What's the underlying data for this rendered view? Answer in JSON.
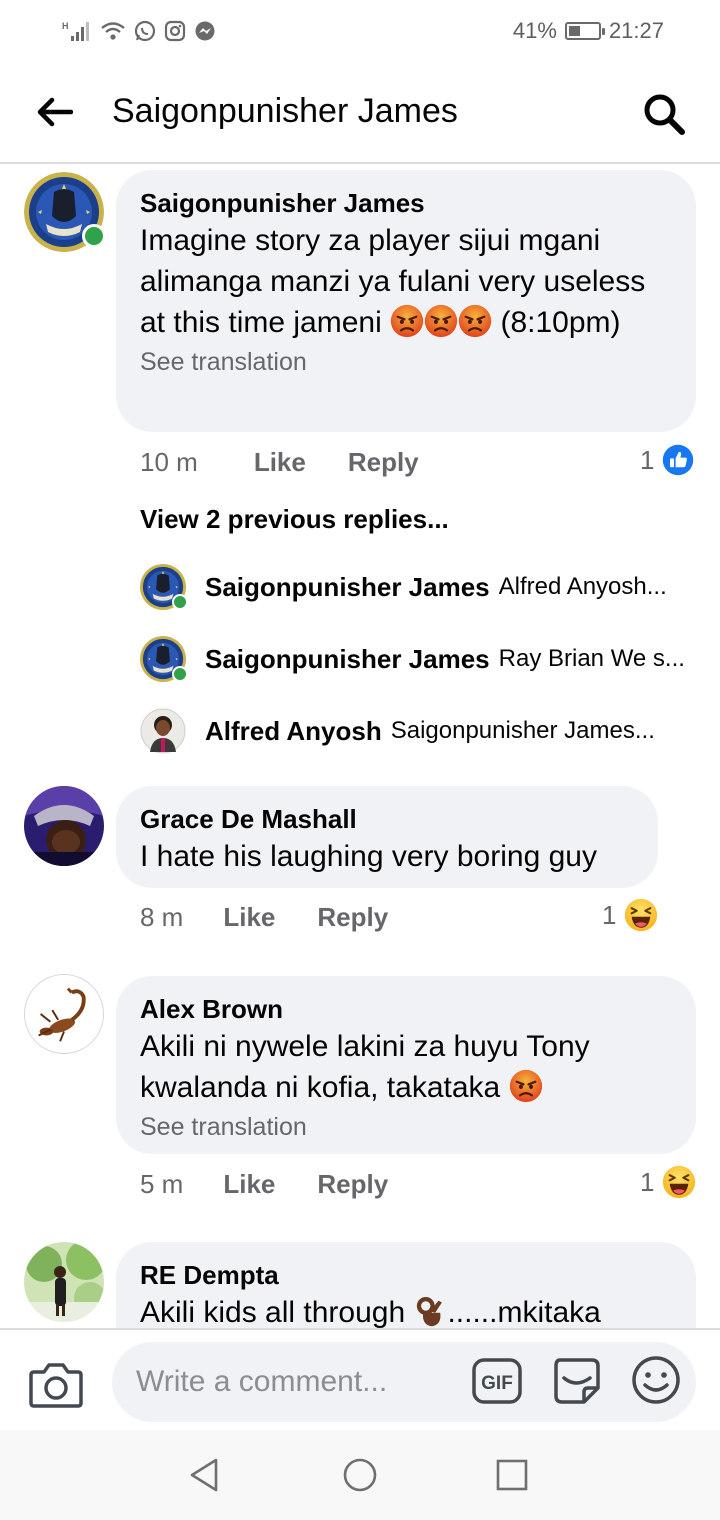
{
  "status_bar": {
    "battery": "41%",
    "time": "21:27",
    "battery_level": 0.41
  },
  "header": {
    "title": "Saigonpunisher James"
  },
  "comments": [
    {
      "author": "Saigonpunisher James",
      "text": "Imagine story za player sijui mgani alimanga manzi ya fulani very useless at this time jameni",
      "text_suffix": "(8:10pm)",
      "see_translation": "See translation",
      "time": "10 m",
      "like": "Like",
      "reply": "Reply",
      "reaction_count": "1",
      "reaction": "like"
    },
    {
      "author": "Grace De Mashall",
      "text": "I hate his laughing very boring guy",
      "time": "8 m",
      "like": "Like",
      "reply": "Reply",
      "reaction_count": "1",
      "reaction": "haha"
    },
    {
      "author": "Alex Brown",
      "text": "Akili ni nywele lakini za huyu Tony kwalanda ni kofia, takataka",
      "see_translation": "See translation",
      "time": "5 m",
      "like": "Like",
      "reply": "Reply",
      "reaction_count": "1",
      "reaction": "haha"
    },
    {
      "author": "RE Dempta",
      "text_before": "Akili kids all through",
      "text_after": "......mkitaka"
    }
  ],
  "replies": {
    "view_previous": "View 2 previous replies...",
    "items": [
      {
        "author": "Saigonpunisher James",
        "preview": "Alfred Anyosh..."
      },
      {
        "author": "Saigonpunisher James",
        "preview": "Ray Brian We s..."
      },
      {
        "author": "Alfred Anyosh",
        "preview": "Saigonpunisher James..."
      }
    ]
  },
  "composer": {
    "placeholder": "Write a comment...",
    "gif_label": "GIF"
  },
  "colors": {
    "bubble": "#f0f2f5",
    "meta_text": "#65676b",
    "online": "#31a24c",
    "like_blue": "#1877f2"
  },
  "icons": [
    "back-arrow-icon",
    "search-icon",
    "camera-icon",
    "gif-icon",
    "sticker-icon",
    "smiley-icon",
    "nav-back-icon",
    "nav-home-icon",
    "nav-recents-icon"
  ]
}
